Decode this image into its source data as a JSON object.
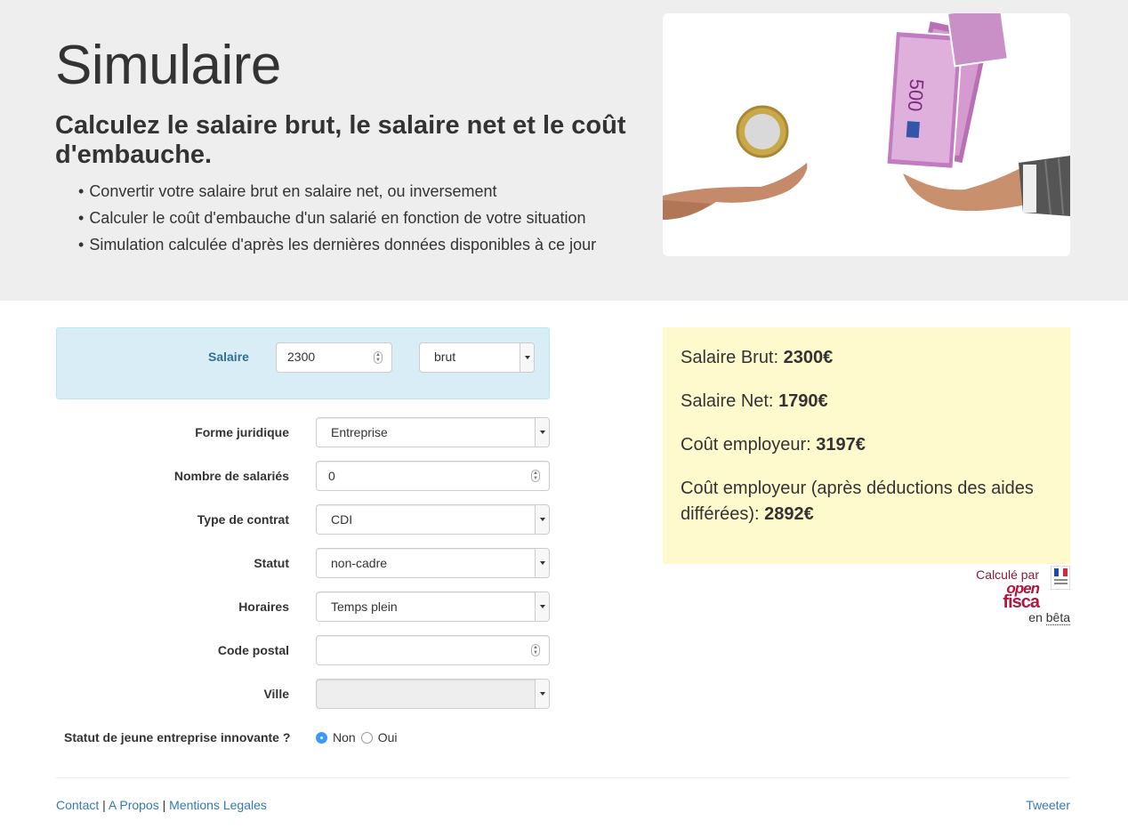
{
  "header": {
    "title": "Simulaire",
    "subtitle": "Calculez le salaire brut, le salaire net et le coût d'embauche.",
    "bullets": [
      "Convertir votre salaire brut en salaire net, ou inversement",
      "Calculer le coût d'embauche d'un salarié en fonction de votre situation",
      "Simulation calculée d'après les dernières données disponibles à ce jour"
    ]
  },
  "salary": {
    "label": "Salaire",
    "value": "2300",
    "type": "brut"
  },
  "form": {
    "forme_juridique": {
      "label": "Forme juridique",
      "value": "Entreprise"
    },
    "nombre_salaries": {
      "label": "Nombre de salariés",
      "value": "0"
    },
    "type_contrat": {
      "label": "Type de contrat",
      "value": "CDI"
    },
    "statut": {
      "label": "Statut",
      "value": "non-cadre"
    },
    "horaires": {
      "label": "Horaires",
      "value": "Temps plein"
    },
    "code_postal": {
      "label": "Code postal",
      "value": ""
    },
    "ville": {
      "label": "Ville",
      "value": ""
    },
    "jei": {
      "label": "Statut de jeune entreprise innovante ?",
      "option_non": "Non",
      "option_oui": "Oui",
      "selected": "Non"
    }
  },
  "results": {
    "brut_label": "Salaire Brut: ",
    "brut_value": "2300€",
    "net_label": "Salaire Net: ",
    "net_value": "1790€",
    "cout_label": "Coût employeur: ",
    "cout_value": "3197€",
    "cout_aides_label": "Coût employeur (après déductions des aides différées): ",
    "cout_aides_value": "2892€"
  },
  "openfisca": {
    "calc_by": "Calculé par",
    "logo_open": "open",
    "logo_fisca": "fisca",
    "en": "en ",
    "beta": "bêta"
  },
  "footer": {
    "contact": "Contact",
    "sep": " | ",
    "apropos": "A Propos",
    "mentions": "Mentions Legales",
    "tweet": "Tweeter"
  },
  "colors": {
    "jumbotron_bg": "#eeeeee",
    "info_panel_bg": "#d9edf7",
    "results_bg": "#fffacd",
    "link": "#337ab7",
    "openfisca_brand": "#b0173e"
  }
}
